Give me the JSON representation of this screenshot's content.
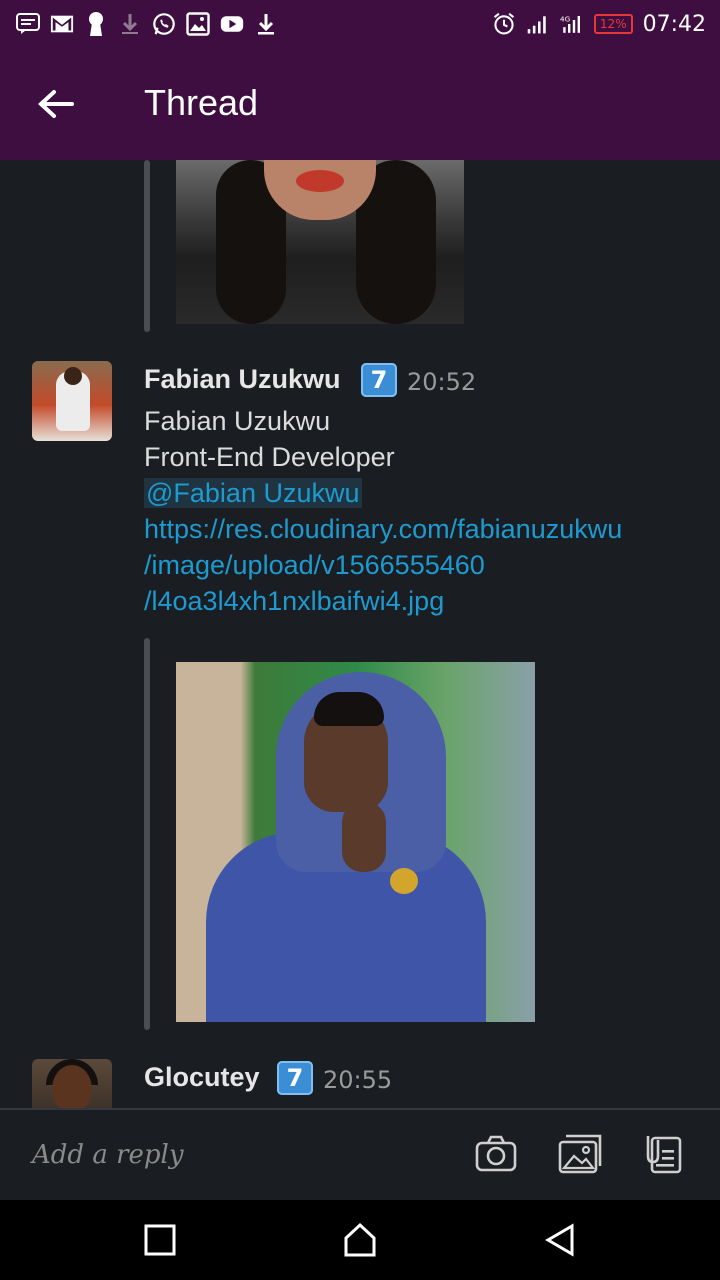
{
  "status_bar": {
    "time": "07:42",
    "battery": "12%",
    "icons": [
      "message-icon",
      "gmail-icon",
      "keyhole-icon",
      "download-icon",
      "whatsapp-icon",
      "image-icon",
      "youtube-icon",
      "download-icon",
      "alarm-icon",
      "signal-icon",
      "signal-icon"
    ]
  },
  "header": {
    "title": "Thread"
  },
  "messages": [
    {
      "name": "Fabian Uzukwu",
      "badge": "7",
      "time": "20:52",
      "lines": [
        "Fabian Uzukwu",
        "Front-End Developer"
      ],
      "mention": "@Fabian Uzukwu",
      "link_lines": [
        "https://res.cloudinary.com/fabianuzukwu",
        "/image/upload/v1566555460",
        "/l4oa3l4xh1nxlbaifwi4.jpg"
      ]
    },
    {
      "name": "Glocutey",
      "badge": "7",
      "time": "20:55"
    }
  ],
  "reply": {
    "placeholder": "Add a reply"
  },
  "colors": {
    "header": "#3f0e40",
    "background": "#1a1d21",
    "link": "#1d9bd1",
    "badge": "#3b8dd6"
  }
}
